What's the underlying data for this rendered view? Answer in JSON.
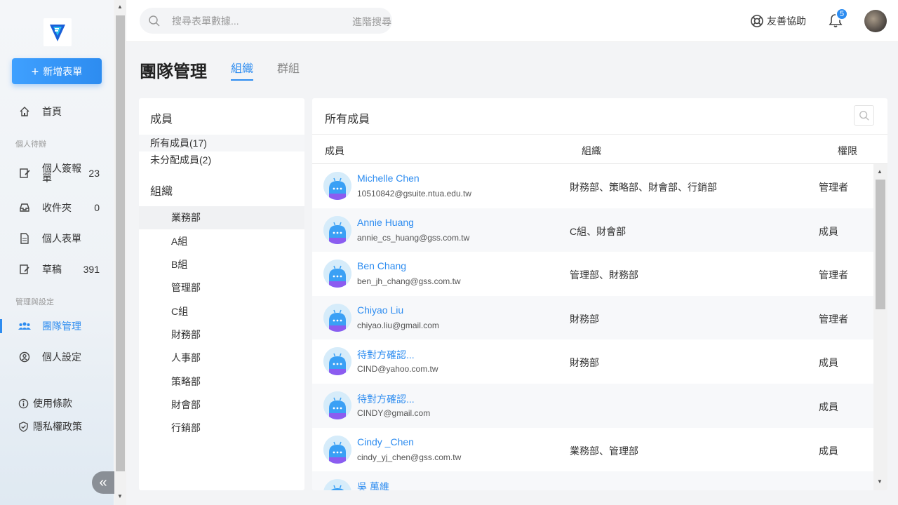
{
  "sidebar": {
    "new_form_label": "新增表單",
    "home_label": "首頁",
    "section_personal": "個人待辦",
    "items_personal": [
      {
        "label": "個人簽報單",
        "count": "23"
      },
      {
        "label": "收件夾",
        "count": "0"
      },
      {
        "label": "個人表單",
        "count": ""
      },
      {
        "label": "草稿",
        "count": "391"
      }
    ],
    "section_admin": "管理與設定",
    "team_label": "團隊管理",
    "settings_label": "個人設定",
    "terms_label": "使用條款",
    "privacy_label": "隱私權政策",
    "collapse_glyph": "«"
  },
  "topbar": {
    "search_placeholder": "搜尋表單數據...",
    "advanced_search": "進階搜尋",
    "help_label": "友善協助",
    "notification_count": "5"
  },
  "page": {
    "title": "團隊管理",
    "tabs": [
      {
        "label": "組織",
        "active": true
      },
      {
        "label": "群組",
        "active": false
      }
    ]
  },
  "left_panel": {
    "members_title": "成員",
    "all_members": "所有成員(17)",
    "unassigned": "未分配成員(2)",
    "org_title": "組織",
    "orgs": [
      "業務部",
      "A組",
      "B組",
      "管理部",
      "C組",
      "財務部",
      "人事部",
      "策略部",
      "財會部",
      "行銷部"
    ]
  },
  "right_panel": {
    "title": "所有成員",
    "columns": [
      "成員",
      "組織",
      "權限"
    ],
    "rows": [
      {
        "name": "Michelle Chen",
        "email": "10510842@gsuite.ntua.edu.tw",
        "org": "財務部、策略部、財會部、行銷部",
        "perm": "管理者"
      },
      {
        "name": "Annie Huang",
        "email": "annie_cs_huang@gss.com.tw",
        "org": "C組、財會部",
        "perm": "成員"
      },
      {
        "name": "Ben Chang",
        "email": "ben_jh_chang@gss.com.tw",
        "org": "管理部、財務部",
        "perm": "管理者"
      },
      {
        "name": "Chiyao Liu",
        "email": "chiyao.liu@gmail.com",
        "org": "財務部",
        "perm": "管理者"
      },
      {
        "name": "待對方確認...",
        "email": "CIND@yahoo.com.tw",
        "org": "財務部",
        "perm": "成員"
      },
      {
        "name": "待對方確認...",
        "email": "CINDY@gmail.com",
        "org": "",
        "perm": "成員"
      },
      {
        "name": "Cindy _Chen",
        "email": "cindy_yj_chen@gss.com.tw",
        "org": "業務部、管理部",
        "perm": "成員"
      },
      {
        "name": "吳 萬維",
        "email": "",
        "org": "",
        "perm": ""
      }
    ]
  }
}
